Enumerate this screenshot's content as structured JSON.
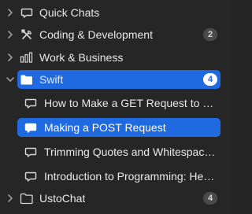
{
  "sidebar": {
    "items": [
      {
        "label": "Quick Chats",
        "icon": "chat-bubble-icon",
        "expanded": false
      },
      {
        "label": "Coding & Development",
        "icon": "tools-icon",
        "badge": "2",
        "expanded": false
      },
      {
        "label": "Work & Business",
        "icon": "bar-chart-icon",
        "expanded": false
      },
      {
        "label": "Swift",
        "icon": "folder-icon",
        "badge": "4",
        "expanded": true,
        "selected": true,
        "children": [
          {
            "label": "How to Make a GET Request to an...",
            "icon": "chat-bubble-icon"
          },
          {
            "label": "Making a POST Request",
            "icon": "chat-bubble-icon",
            "selected": true
          },
          {
            "label": "Trimming Quotes and Whitespace...",
            "icon": "chat-bubble-icon"
          },
          {
            "label": "Introduction to Programming: Hell...",
            "icon": "chat-bubble-icon"
          }
        ]
      },
      {
        "label": "UstoChat",
        "icon": "folder-icon",
        "badge": "4",
        "expanded": false
      }
    ]
  },
  "colors": {
    "background": "#262626",
    "selection": "#1f6ae0",
    "badge": "#4a4a4a"
  }
}
